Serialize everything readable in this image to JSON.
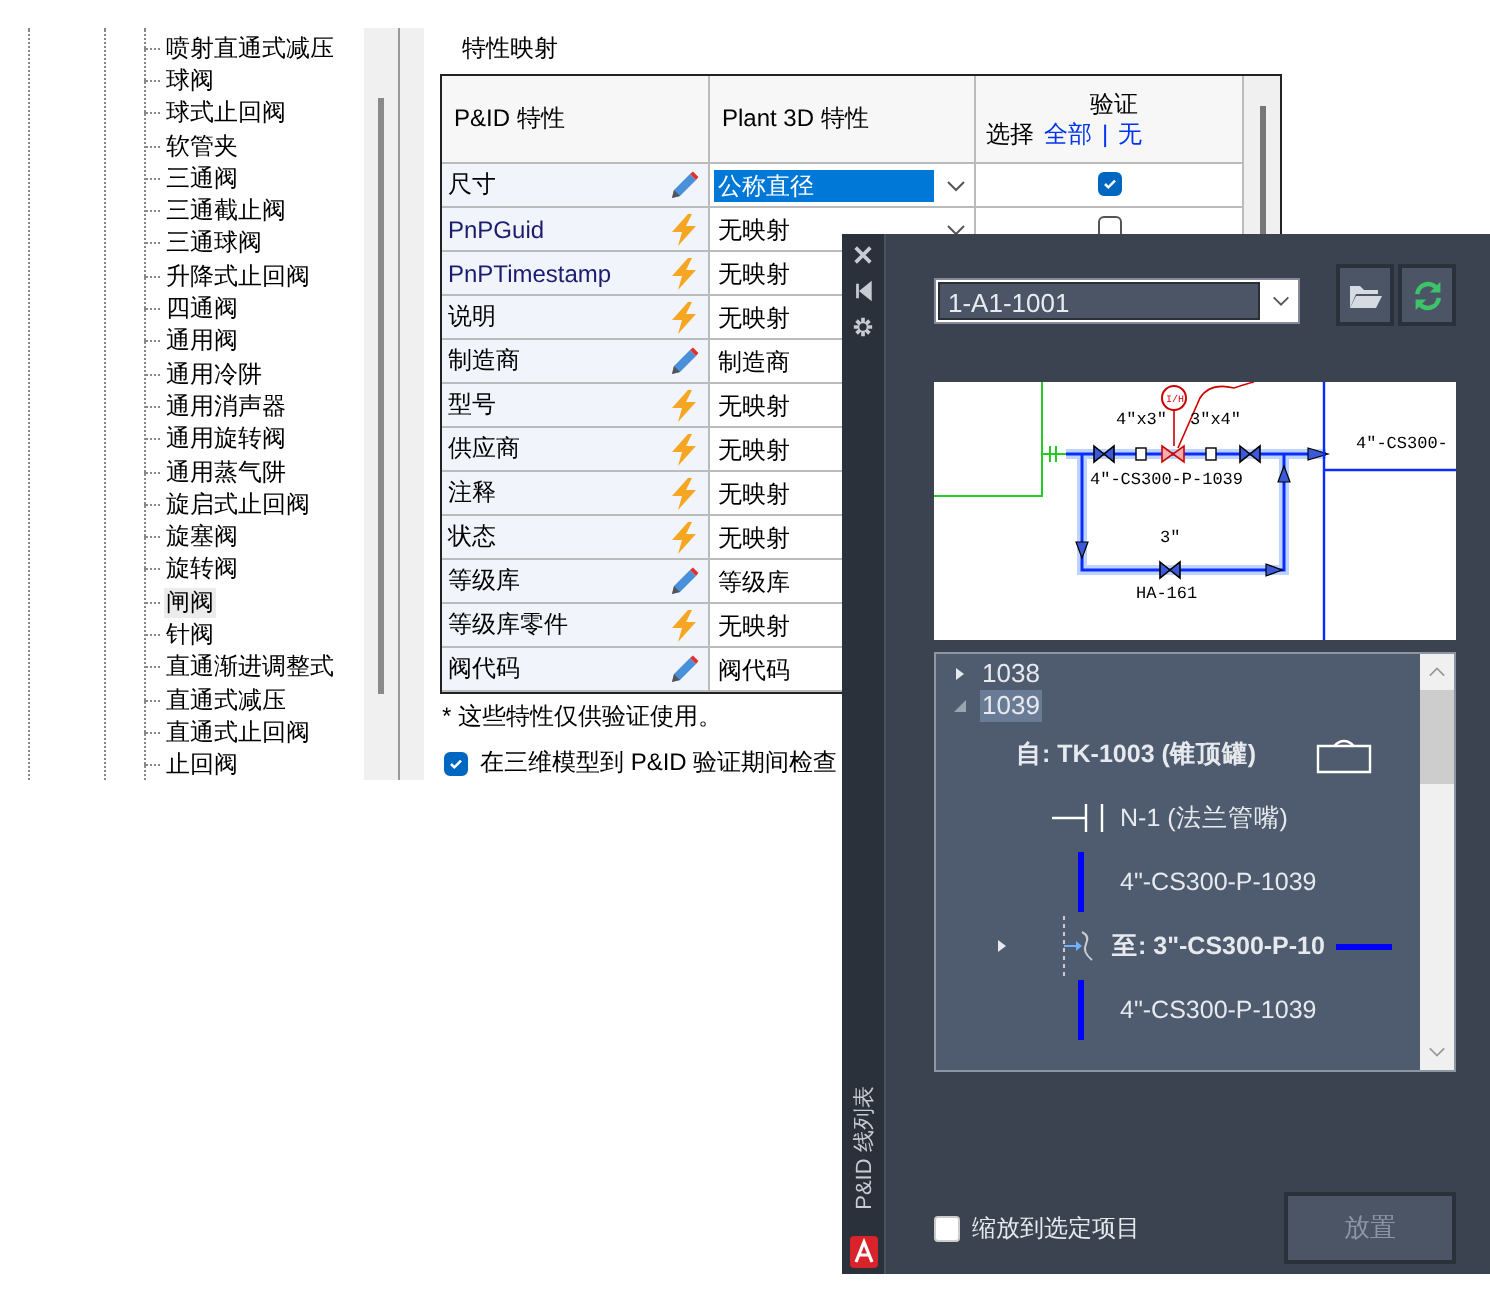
{
  "valve_tree": {
    "items": [
      {
        "label": "喷射直通式减压",
        "selected": false
      },
      {
        "label": "球阀",
        "selected": false
      },
      {
        "label": "球式止回阀",
        "selected": false
      },
      {
        "label": "软管夹",
        "selected": false
      },
      {
        "label": "三通阀",
        "selected": false
      },
      {
        "label": "三通截止阀",
        "selected": false
      },
      {
        "label": "三通球阀",
        "selected": false
      },
      {
        "label": "升降式止回阀",
        "selected": false
      },
      {
        "label": "四通阀",
        "selected": false
      },
      {
        "label": "通用阀",
        "selected": false
      },
      {
        "label": "通用冷阱",
        "selected": false
      },
      {
        "label": "通用消声器",
        "selected": false
      },
      {
        "label": "通用旋转阀",
        "selected": false
      },
      {
        "label": "通用蒸气阱",
        "selected": false
      },
      {
        "label": "旋启式止回阀",
        "selected": false
      },
      {
        "label": "旋塞阀",
        "selected": false
      },
      {
        "label": "旋转阀",
        "selected": false
      },
      {
        "label": "闸阀",
        "selected": true
      },
      {
        "label": "针阀",
        "selected": false
      },
      {
        "label": "直通渐进调整式",
        "selected": false
      },
      {
        "label": "直通式减压",
        "selected": false
      },
      {
        "label": "直通式止回阀",
        "selected": false
      },
      {
        "label": "止回阀",
        "selected": false
      }
    ]
  },
  "property_mapping": {
    "title": "特性映射",
    "columns": {
      "pid": "P&ID 特性",
      "plant": "Plant 3D 特性",
      "verify": "验证",
      "select_label": "选择",
      "select_all": "全部",
      "separator": "|",
      "select_none": "无"
    },
    "rows": [
      {
        "pid": "尺寸",
        "kind": "edit",
        "plant": "公称直径",
        "selected": true,
        "dropdown": true,
        "verify": true
      },
      {
        "pid": "PnPGuid",
        "kind": "auto",
        "plant": "无映射",
        "selected": false,
        "dropdown": true,
        "verify": false
      },
      {
        "pid": "PnPTimestamp",
        "kind": "auto",
        "plant": "无映射",
        "selected": false
      },
      {
        "pid": "说明",
        "kind": "auto",
        "plant": "无映射",
        "selected": false
      },
      {
        "pid": "制造商",
        "kind": "edit",
        "plant": "制造商",
        "selected": false
      },
      {
        "pid": "型号",
        "kind": "auto",
        "plant": "无映射",
        "selected": false
      },
      {
        "pid": "供应商",
        "kind": "auto",
        "plant": "无映射",
        "selected": false
      },
      {
        "pid": "注释",
        "kind": "auto",
        "plant": "无映射",
        "selected": false
      },
      {
        "pid": "状态",
        "kind": "auto",
        "plant": "无映射",
        "selected": false
      },
      {
        "pid": "等级库",
        "kind": "edit",
        "plant": "等级库",
        "selected": false
      },
      {
        "pid": "等级库零件",
        "kind": "auto",
        "plant": "无映射",
        "selected": false
      },
      {
        "pid": "阀代码",
        "kind": "edit",
        "plant": "阀代码",
        "selected": false
      }
    ],
    "footnote": "* 这些特性仅供验证使用。",
    "check_option": {
      "label": "在三维模型到 P&ID 验证期间检查",
      "checked": true
    }
  },
  "line_list_panel": {
    "title": "P&ID 线列表",
    "drawing": {
      "value": "1-A1-1001"
    },
    "preview_labels": [
      "4\"x3\"",
      "3\"x4\"",
      "4\"-CS300-P-1039",
      "3\"",
      "HA-161",
      "4\"-CS300-",
      "I/H"
    ],
    "tree": [
      {
        "label": "1038",
        "expanded": false,
        "selected": false
      },
      {
        "label": "1039",
        "expanded": true,
        "selected": true,
        "children": [
          {
            "kind": "source",
            "label": "自: TK-1003  (锥顶罐)"
          },
          {
            "kind": "nozzle",
            "label": "N-1  (法兰管嘴)"
          },
          {
            "kind": "pipe",
            "label": "4\"-CS300-P-1039"
          },
          {
            "kind": "branch",
            "label": "至: 3\"-CS300-P-10",
            "expanded": false
          },
          {
            "kind": "pipe",
            "label": "4\"-CS300-P-1039"
          }
        ]
      }
    ],
    "zoom_option": {
      "label": "缩放到选定项目",
      "checked": false
    },
    "place_button": {
      "label": "放置",
      "disabled": true
    }
  }
}
